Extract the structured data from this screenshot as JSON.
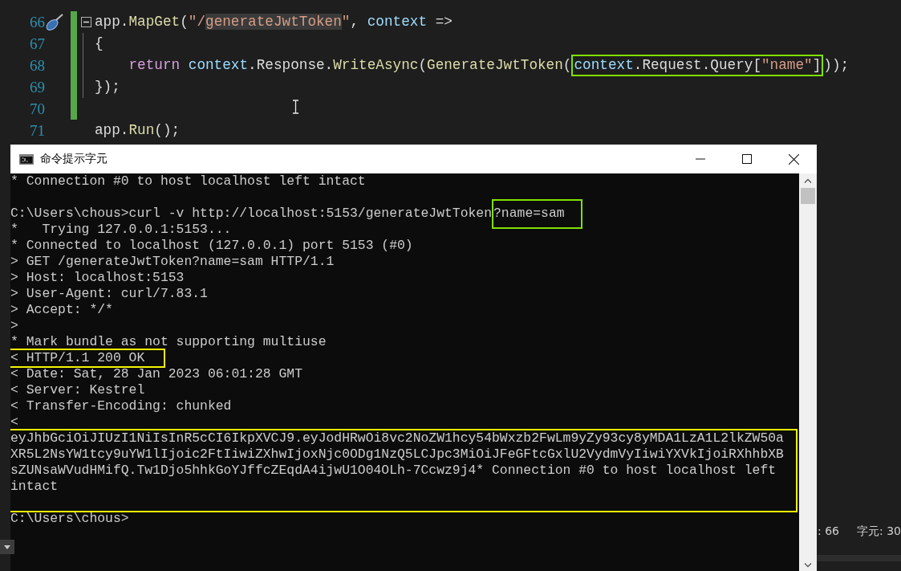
{
  "editor": {
    "lines": [
      {
        "number": "66",
        "changed": true,
        "quick_action": true,
        "collapsible": true,
        "in_block": false,
        "segments": [
          {
            "boxed": false,
            "tokens": [
              {
                "kind": "plain",
                "text": "app."
              },
              {
                "kind": "method",
                "text": "MapGet"
              },
              {
                "kind": "plain",
                "text": "("
              },
              {
                "kind": "string",
                "text": "\"/"
              },
              {
                "kind": "string_match",
                "text": "generateJwtToken"
              },
              {
                "kind": "string",
                "text": "\""
              },
              {
                "kind": "plain",
                "text": ", "
              },
              {
                "kind": "param",
                "text": "context"
              },
              {
                "kind": "plain",
                "text": " =>"
              }
            ]
          }
        ]
      },
      {
        "number": "67",
        "changed": true,
        "quick_action": false,
        "collapsible": false,
        "in_block": true,
        "segments": [
          {
            "boxed": false,
            "tokens": [
              {
                "kind": "plain",
                "text": "{"
              }
            ]
          }
        ]
      },
      {
        "number": "68",
        "changed": true,
        "quick_action": false,
        "collapsible": false,
        "in_block": true,
        "segments": [
          {
            "boxed": false,
            "tokens": [
              {
                "kind": "keyword",
                "text": "    return "
              },
              {
                "kind": "param",
                "text": "context"
              },
              {
                "kind": "plain",
                "text": ".Response."
              },
              {
                "kind": "method",
                "text": "WriteAsync"
              },
              {
                "kind": "plain",
                "text": "("
              },
              {
                "kind": "method",
                "text": "GenerateJwtToken"
              },
              {
                "kind": "plain",
                "text": "("
              }
            ]
          },
          {
            "boxed": true,
            "tokens": [
              {
                "kind": "param",
                "text": "context"
              },
              {
                "kind": "plain",
                "text": ".Request.Query["
              },
              {
                "kind": "string",
                "text": "\"name\""
              },
              {
                "kind": "plain",
                "text": "]"
              }
            ]
          },
          {
            "boxed": false,
            "tokens": [
              {
                "kind": "plain",
                "text": "));"
              }
            ]
          }
        ]
      },
      {
        "number": "69",
        "changed": true,
        "quick_action": false,
        "collapsible": false,
        "in_block": true,
        "segments": [
          {
            "boxed": false,
            "tokens": [
              {
                "kind": "plain",
                "text": "});"
              }
            ]
          }
        ]
      },
      {
        "number": "70",
        "changed": true,
        "quick_action": false,
        "collapsible": false,
        "in_block": false
      },
      {
        "number": "71",
        "changed": false,
        "quick_action": false,
        "collapsible": false,
        "in_block": false,
        "segments": [
          {
            "boxed": false,
            "tokens": [
              {
                "kind": "plain",
                "text": "app."
              },
              {
                "kind": "method",
                "text": "Run"
              },
              {
                "kind": "plain",
                "text": "();"
              }
            ]
          }
        ]
      }
    ]
  },
  "terminal": {
    "title": "命令提示字元",
    "blocks": [
      {
        "boxed": false,
        "lines": [
          {
            "kind": "text",
            "segments": [
              {
                "boxed": false,
                "text": "* Connection #0 to host localhost left intact"
              }
            ]
          },
          {
            "kind": "blank"
          },
          {
            "kind": "text",
            "segments": [
              {
                "boxed": false,
                "text": "C:\\Users\\chous>curl -v http://localhost:5153/generateJwtToken"
              },
              {
                "boxed": true,
                "text": "?name=sam"
              }
            ]
          },
          {
            "kind": "text",
            "segments": [
              {
                "boxed": false,
                "text": "*   Trying 127.0.0.1:5153..."
              }
            ]
          },
          {
            "kind": "text",
            "segments": [
              {
                "boxed": false,
                "text": "* Connected to localhost (127.0.0.1) port 5153 (#0)"
              }
            ]
          },
          {
            "kind": "text",
            "segments": [
              {
                "boxed": false,
                "text": "> GET /generateJwtToken?name=sam HTTP/1.1"
              }
            ]
          },
          {
            "kind": "text",
            "segments": [
              {
                "boxed": false,
                "text": "> Host: localhost:5153"
              }
            ]
          },
          {
            "kind": "text",
            "segments": [
              {
                "boxed": false,
                "text": "> User-Agent: curl/7.83.1"
              }
            ]
          },
          {
            "kind": "text",
            "segments": [
              {
                "boxed": false,
                "text": "> Accept: */*"
              }
            ]
          },
          {
            "kind": "text",
            "segments": [
              {
                "boxed": false,
                "text": ">"
              }
            ]
          },
          {
            "kind": "text",
            "segments": [
              {
                "boxed": false,
                "text": "* Mark bundle as not supporting multiuse"
              }
            ]
          }
        ]
      },
      {
        "boxed": true,
        "lines": [
          {
            "kind": "text",
            "segments": [
              {
                "boxed": false,
                "text": "< HTTP/1.1 200 OK"
              }
            ]
          }
        ]
      },
      {
        "boxed": false,
        "lines": [
          {
            "kind": "text",
            "segments": [
              {
                "boxed": false,
                "text": "< Date: Sat, 28 Jan 2023 06:01:28 GMT"
              }
            ]
          },
          {
            "kind": "text",
            "segments": [
              {
                "boxed": false,
                "text": "< Server: Kestrel"
              }
            ]
          },
          {
            "kind": "text",
            "segments": [
              {
                "boxed": false,
                "text": "< Transfer-Encoding: chunked"
              }
            ]
          },
          {
            "kind": "text",
            "segments": [
              {
                "boxed": false,
                "text": "<"
              }
            ]
          }
        ]
      },
      {
        "boxed": true,
        "lines": [
          {
            "kind": "text",
            "segments": [
              {
                "boxed": false,
                "text": "eyJhbGciOiJIUzI1NiIsInR5cCI6IkpXVCJ9.eyJodHRwOi8vc2NoZW1hcy54bWxzb2FwLm9yZy93cy8yMDA1LzA1L2lkZW50a"
              }
            ]
          },
          {
            "kind": "text",
            "segments": [
              {
                "boxed": false,
                "text": "XR5L2NsYW1tcy9uYW1lIjoic2FtIiwiZXhwIjoxNjc0ODg1NzQ5LCJpc3MiOiJFeGFtcGxlU2VydmVyIiwiYXVkIjoiRXhhbXB"
              }
            ]
          },
          {
            "kind": "text",
            "segments": [
              {
                "boxed": false,
                "text": "sZUNsaWVudHMifQ.Tw1Djo5hhkGoYJffcZEqdA4ijwU1O04OLh-7Ccwz9j4* Connection #0 to host localhost left"
              }
            ]
          },
          {
            "kind": "text",
            "segments": [
              {
                "boxed": false,
                "text": "intact"
              }
            ]
          },
          {
            "kind": "blank"
          }
        ]
      },
      {
        "boxed": false,
        "lines": [
          {
            "kind": "text",
            "segments": [
              {
                "boxed": false,
                "text": "C:\\Users\\chous>"
              }
            ]
          }
        ]
      }
    ]
  },
  "status_bar": {
    "line": ": 66",
    "column": "字元: 30"
  }
}
